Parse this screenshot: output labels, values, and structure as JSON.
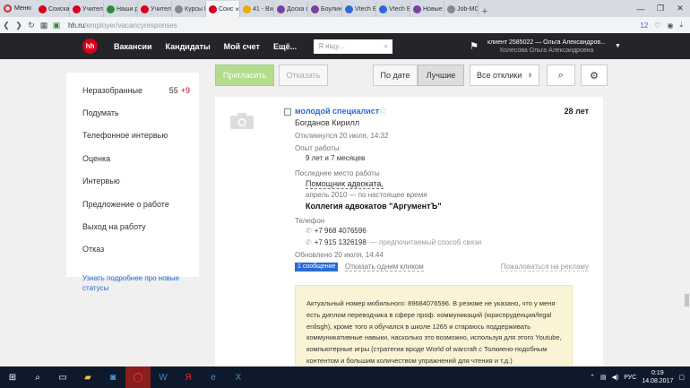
{
  "browser": {
    "menu_label": "Меню",
    "tabs": [
      {
        "label": "Соискат",
        "color": "#d6001c"
      },
      {
        "label": "Учитель",
        "color": "#d6001c"
      },
      {
        "label": "Наши р",
        "color": "#2e8b3a"
      },
      {
        "label": "Учитель",
        "color": "#d6001c"
      },
      {
        "label": "Курсы E",
        "color": "#888888"
      },
      {
        "label": "Соис",
        "color": "#d6001c",
        "active": true
      },
      {
        "label": "41 - Вхо",
        "color": "#f2a900"
      },
      {
        "label": "Доска о",
        "color": "#7b3fa0"
      },
      {
        "label": "Боулин",
        "color": "#7b3fa0"
      },
      {
        "label": "Vtech Б",
        "color": "#2a6bd1"
      },
      {
        "label": "Vtech Б",
        "color": "#2a6bd1"
      },
      {
        "label": "Новые р",
        "color": "#7b3fa0"
      },
      {
        "label": "Job-MO",
        "color": "#888888"
      }
    ],
    "tab_close": "×",
    "url_host": "hh.ru",
    "url_path": "/employer/vacancyresponses",
    "ext_badge": "12"
  },
  "site": {
    "logo": "hh",
    "nav": [
      "Вакансии",
      "Кандидаты",
      "Мой счет",
      "Ещё..."
    ],
    "search_placeholder": "Я ищу...",
    "account_name": "клиент 2585022 — Ольга Александров...",
    "account_sub": "Колесова Ольга Александровна"
  },
  "toolbar": {
    "invite": "Пригласить",
    "refuse": "Отказать",
    "by_date": "По дате",
    "best": "Лучшие",
    "all_responses": "Все отклики"
  },
  "sidebar": {
    "items": [
      {
        "label": "Неразобранные",
        "count": "55",
        "new": "+9"
      },
      {
        "label": "Подумать"
      },
      {
        "label": "Телефонное интервью"
      },
      {
        "label": "Оценка"
      },
      {
        "label": "Интервью"
      },
      {
        "label": "Предложение о работе"
      },
      {
        "label": "Выход на работу"
      },
      {
        "label": "Отказ"
      }
    ],
    "learn_more": "Узнать подробнее про новые статусы"
  },
  "candidate": {
    "vacancy": "молодой специалист",
    "age": "28 лет",
    "name": "Богданов Кирилл",
    "responded": "Откликнулся 20 июля, 14:32",
    "exp_label": "Опыт работы",
    "exp_value": "9 лет и 7 месяцев",
    "last_job_label": "Последнее место работы",
    "position": "Помощник адвоката,",
    "period": "апрель 2010 — по настоящее время",
    "company": "Коллегия адвокатов \"АргументЪ\"",
    "phone_label": "Телефон",
    "phone1": "+7 968 4076596",
    "phone2": "+7 915 1326198",
    "phone2_note": "— предпочитаемый способ связи",
    "updated": "Обновлено 20 июля, 14:44",
    "msg_badge": "1 сообщение",
    "refuse_link": "Отказать одним кликом",
    "complain_link": "Пожаловаться на рекламу",
    "letter": "Актуальный номер мобильного: 89684076596. В резюме не указано, что у меня есть диплом переводчика в сфере проф. коммуникаций (юриспруденция/legal enlisgh), кроме того я обучался в школе 1265 и стараюсь поддерживать коммуникативные навыки, насколько это возможно, используя для этого Youtube, компьютерные игры (стратегии вроде World of warcraft с Толкиено-подобным контентом и большим количеством упражнений для чтения и т.д.)"
  },
  "taskbar": {
    "lang": "РУС",
    "time": "0:19",
    "date": "14.08.2017"
  }
}
